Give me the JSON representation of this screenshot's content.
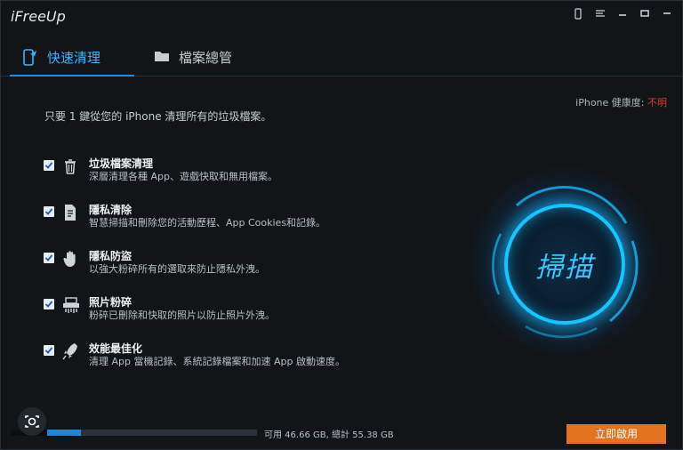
{
  "app": {
    "title": "iFreeUp"
  },
  "window_controls": [
    "phone-icon",
    "menu-icon",
    "minimize-icon",
    "maximize-icon",
    "close-icon"
  ],
  "tabs": [
    {
      "label": "快速清理",
      "icon": "phone-brush-icon",
      "active": true
    },
    {
      "label": "檔案總管",
      "icon": "folder-icon",
      "active": false
    }
  ],
  "intro": "只要 1 鍵從您的 iPhone 清理所有的垃圾檔案。",
  "health": {
    "label": "iPhone 健康度:",
    "value": "不明",
    "value_color": "#e2362f"
  },
  "features": [
    {
      "title": "垃圾檔案清理",
      "desc": "深層清理各種 App、遊戲快取和無用檔案。",
      "icon": "trash-icon",
      "checked": true
    },
    {
      "title": "隱私清除",
      "desc": "智慧掃描和刪除您的活動歷程、App Cookies和記錄。",
      "icon": "document-icon",
      "checked": true
    },
    {
      "title": "隱私防盜",
      "desc": "以強大粉碎所有的選取來防止隱私外洩。",
      "icon": "hand-icon",
      "checked": true
    },
    {
      "title": "照片粉碎",
      "desc": "粉碎已刪除和快取的照片以防止照片外洩。",
      "icon": "shredder-icon",
      "checked": true
    },
    {
      "title": "效能最佳化",
      "desc": "清理 App 當機記錄、系統記錄檔案和加速 App 啟動速度。",
      "icon": "rocket-icon",
      "checked": true
    }
  ],
  "scan": {
    "label": "掃描"
  },
  "storage": {
    "available": "可用 46.66 GB",
    "separator": ",",
    "total": "總計 55.38 GB",
    "used_fraction": 0.16
  },
  "cta": {
    "label": "立即啟用",
    "color": "#e3731f"
  },
  "accent": "#1e8fe8"
}
